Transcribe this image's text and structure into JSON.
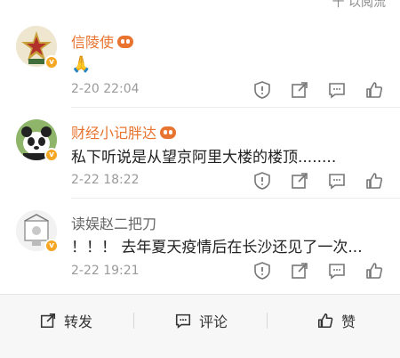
{
  "top_partial": "十 以阅流",
  "comments": [
    {
      "user": "信陵使",
      "text": "🙏",
      "time": "2-20 22:04"
    },
    {
      "user": "财经小记胖达",
      "text": "私下听说是从望京阿里大楼的楼顶........",
      "time": "2-22 18:22"
    },
    {
      "user": "读娱赵二把刀",
      "text": "！！！ 去年夏天疫情后在长沙还见了一次...",
      "time": "2-22 19:21"
    }
  ],
  "bottom_bar": {
    "repost_label": "转发",
    "comment_label": "评论",
    "like_label": "赞"
  },
  "colors": {
    "username": "#e8742f",
    "time": "#9a9a9a",
    "badge": "#f5a623"
  }
}
